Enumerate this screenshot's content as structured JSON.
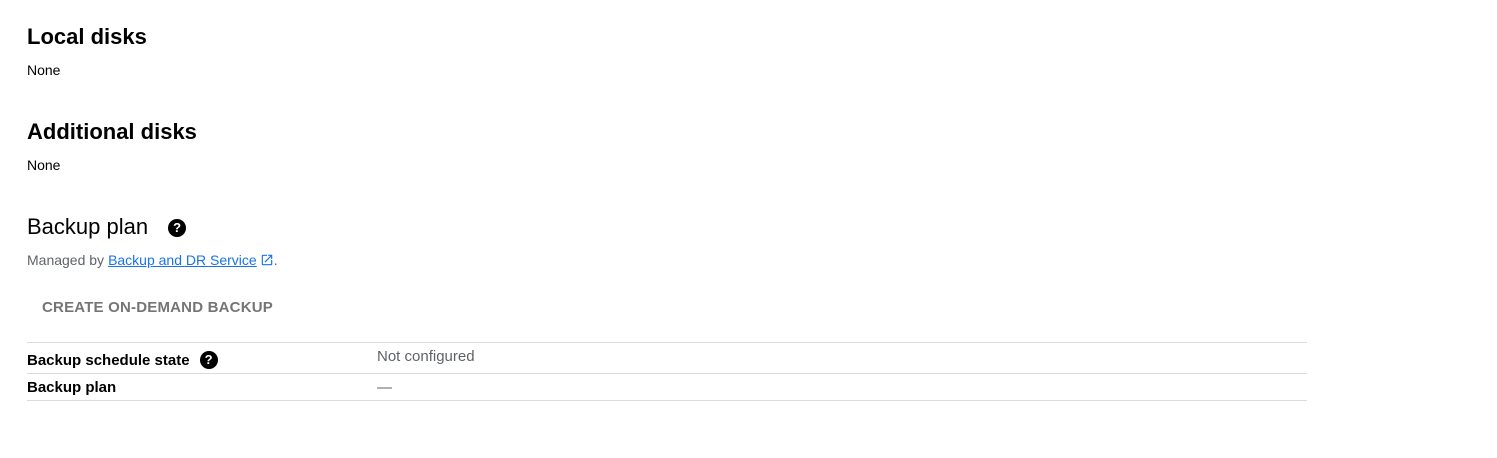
{
  "local_disks": {
    "title": "Local disks",
    "value": "None"
  },
  "additional_disks": {
    "title": "Additional disks",
    "value": "None"
  },
  "backup_plan_section": {
    "title": "Backup plan",
    "help_icon": "?",
    "managed_prefix": "Managed by",
    "managed_link": "Backup and DR Service",
    "managed_suffix": ".",
    "create_button": "CREATE ON-DEMAND BACKUP",
    "rows": [
      {
        "label": "Backup schedule state",
        "value": "Not configured",
        "help_icon": "?"
      },
      {
        "label": "Backup plan",
        "value": "—"
      }
    ]
  },
  "colors": {
    "link": "#1a73e8",
    "muted_text": "#5f6368",
    "disabled_button": "#757575",
    "divider": "#dadce0"
  }
}
